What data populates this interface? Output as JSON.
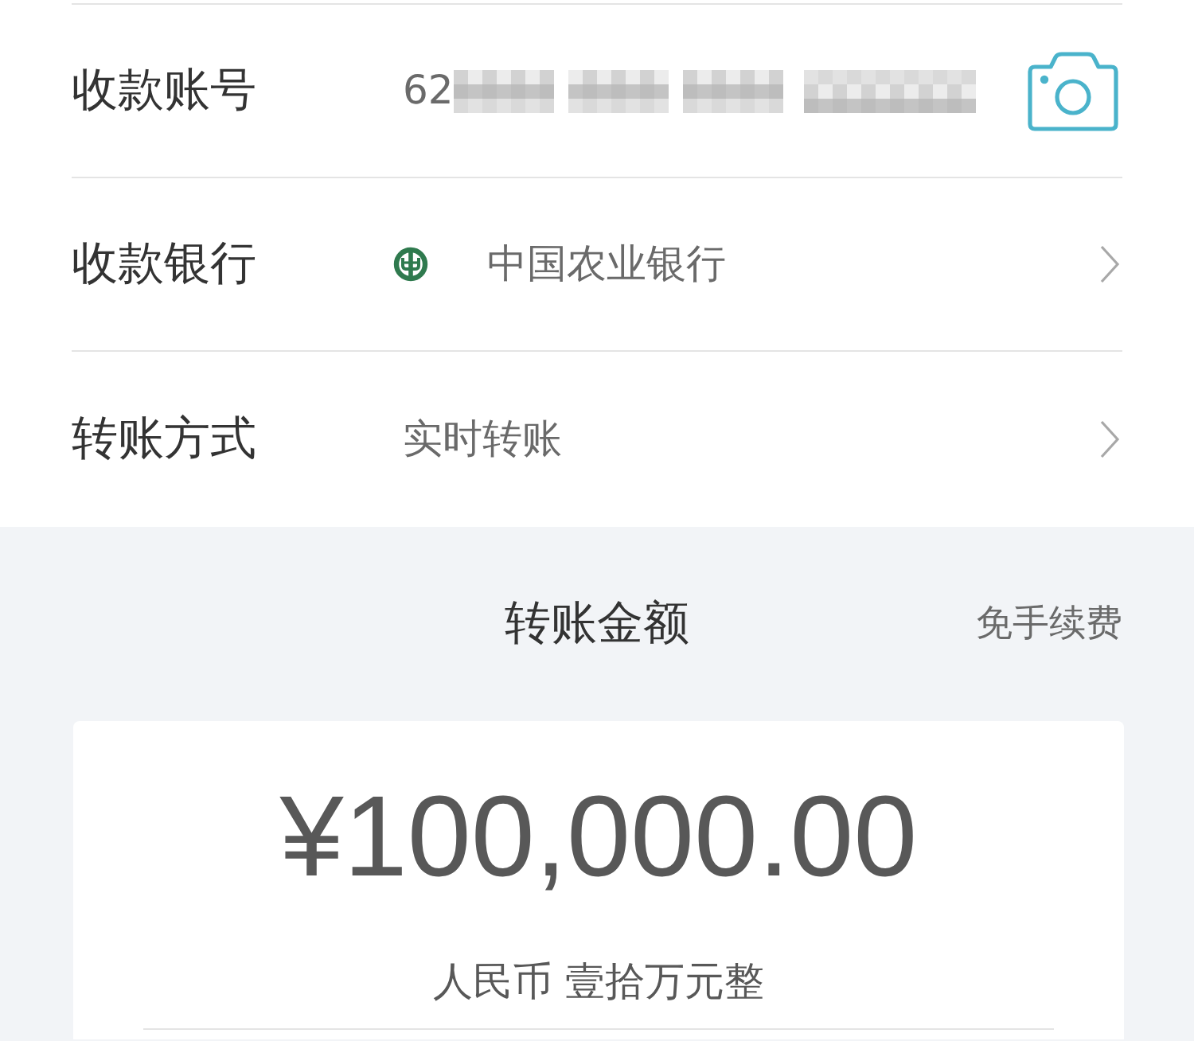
{
  "fields": [
    {
      "kind": "account",
      "label": "收款账号",
      "value": "62",
      "masked": true
    },
    {
      "kind": "bank",
      "label": "收款银行",
      "value": "中国农业银行"
    },
    {
      "kind": "method",
      "label": "转账方式",
      "value": "实时转账"
    }
  ],
  "amount_section": {
    "title": "转账金额",
    "fee_note": "免手续费",
    "amount": "¥100,000.00",
    "amount_in_words": "人民币 壹拾万元整"
  }
}
